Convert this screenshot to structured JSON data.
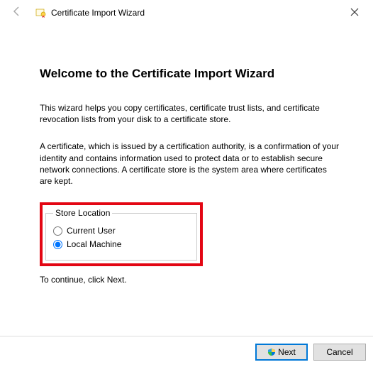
{
  "titlebar": {
    "title": "Certificate Import Wizard"
  },
  "heading": "Welcome to the Certificate Import Wizard",
  "paragraph1": "This wizard helps you copy certificates, certificate trust lists, and certificate revocation lists from your disk to a certificate store.",
  "paragraph2": "A certificate, which is issued by a certification authority, is a confirmation of your identity and contains information used to protect data or to establish secure network connections. A certificate store is the system area where certificates are kept.",
  "storeLocation": {
    "legend": "Store Location",
    "options": {
      "currentUser": "Current User",
      "localMachine": "Local Machine"
    },
    "selected": "localMachine"
  },
  "continueText": "To continue, click Next.",
  "buttons": {
    "next": "Next",
    "cancel": "Cancel"
  }
}
